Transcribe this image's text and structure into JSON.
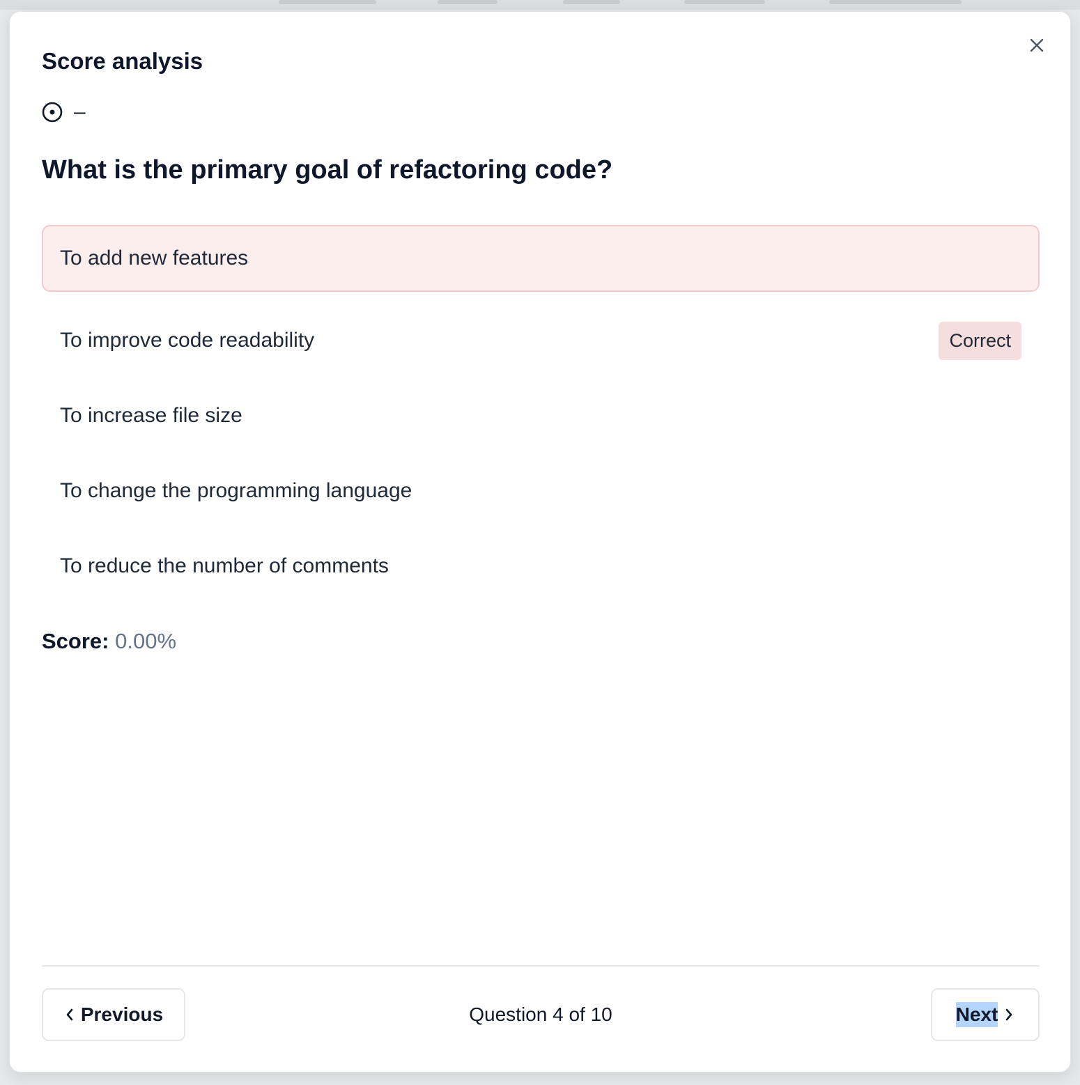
{
  "modal": {
    "title": "Score analysis",
    "status_dash": "–",
    "question": "What is the primary goal of refactoring code?",
    "options": [
      {
        "label": "To add new features",
        "state": "selected-wrong"
      },
      {
        "label": "To improve code readability",
        "badge": "Correct"
      },
      {
        "label": "To increase file size"
      },
      {
        "label": "To change the programming language"
      },
      {
        "label": "To reduce the number of comments"
      }
    ],
    "score": {
      "label": "Score:",
      "value": "0.00%"
    }
  },
  "footer": {
    "previous_label": "Previous",
    "next_label": "Next",
    "progress_text": "Question 4 of 10"
  },
  "icons": {
    "close": "close-icon",
    "status": "radio-dot-icon",
    "previous": "chevron-left-icon",
    "next": "chevron-right-icon"
  },
  "colors": {
    "wrong_bg": "#fdeeee",
    "wrong_border": "#f5c9c9",
    "badge_bg": "#f7dede",
    "score_value": "#64748b",
    "selection_highlight": "#b4d5fe"
  }
}
